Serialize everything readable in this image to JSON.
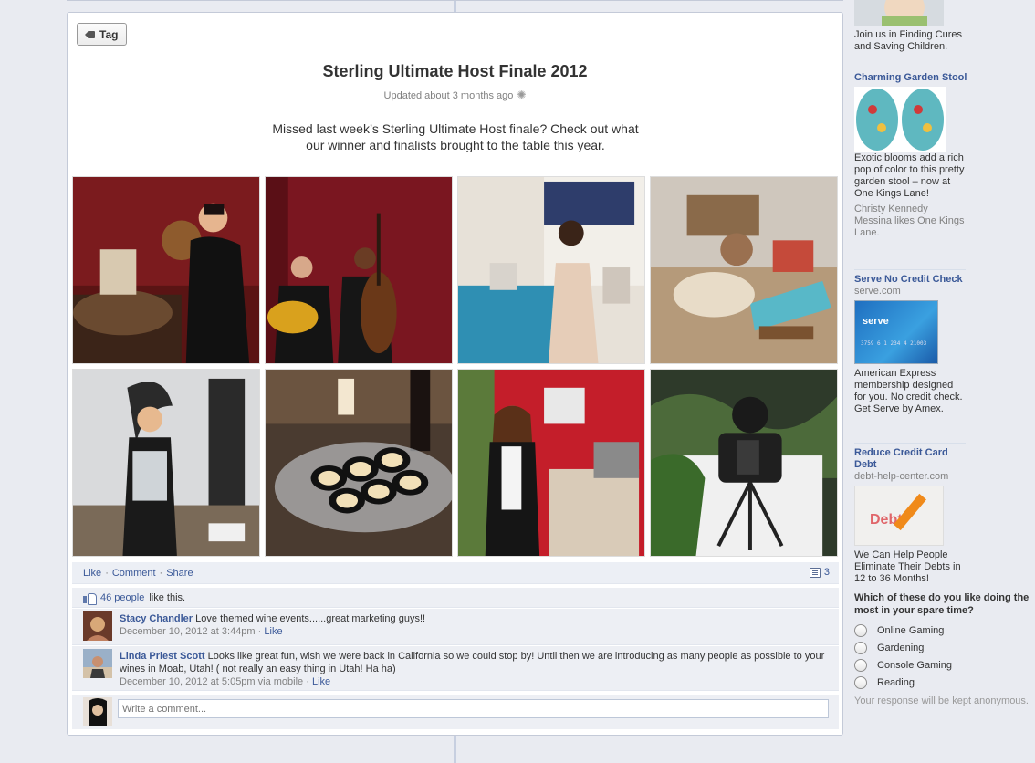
{
  "post": {
    "tag_label": "Tag",
    "title": "Sterling Ultimate Host Finale 2012",
    "updated": "Updated about 3 months ago",
    "description": "Missed last week’s Sterling Ultimate Host finale? Check out what our winner and finalists brought to the table this year.",
    "actions": {
      "like": "Like",
      "comment": "Comment",
      "share": "Share",
      "comment_count": "3"
    },
    "likes": {
      "count_text": "46 people",
      "suffix": "like this."
    },
    "comments": [
      {
        "name": "Stacy Chandler",
        "text": "Love themed wine events......great marketing guys!!",
        "timestamp": "December 10, 2012 at 3:44pm",
        "like": "Like"
      },
      {
        "name": "Linda Priest Scott",
        "text": "Looks like great fun, wish we were back in California so we could stop by! Until then we are introducing as many people as possible to your wines in Moab, Utah! ( not really an easy thing in Utah! Ha ha)",
        "timestamp": "December 10, 2012 at 5:05pm via mobile",
        "like": "Like"
      }
    ],
    "write_placeholder": "Write a comment..."
  },
  "sidebar": {
    "ads": [
      {
        "text": "Join us in Finding Cures and Saving Children."
      },
      {
        "title": "Charming Garden Stool",
        "text": "Exotic blooms add a rich pop of color to this pretty garden stool – now at One Kings Lane!",
        "social": "Christy Kennedy Messina likes One Kings Lane."
      },
      {
        "title": "Serve No Credit Check",
        "domain": "serve.com",
        "text": "American Express membership designed for you. No credit check. Get Serve by Amex.",
        "card_text": "serve",
        "card_number": "3759 6 1 234 4 21003"
      },
      {
        "title": "Reduce Credit Card Debt",
        "domain": "debt-help-center.com",
        "text": "We Can Help People Eliminate Their Debts in 12 to 36 Months!",
        "image_text": "Debt"
      }
    ],
    "poll": {
      "question": "Which of these do you like doing the most in your spare time?",
      "options": [
        "Online Gaming",
        "Gardening",
        "Console Gaming",
        "Reading"
      ],
      "note": "Your response will be kept anonymous."
    }
  }
}
